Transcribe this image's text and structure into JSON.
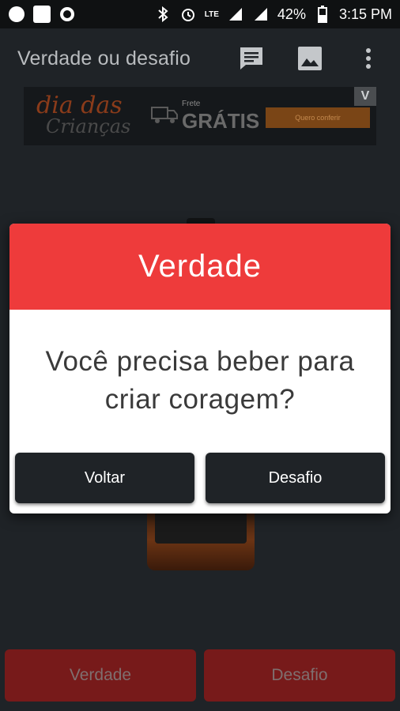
{
  "status_bar": {
    "network": "LTE",
    "battery": "42%",
    "time": "3:15 PM"
  },
  "app_bar": {
    "title": "Verdade ou desafio",
    "icons": [
      "message-icon",
      "image-icon",
      "more-vert-icon"
    ]
  },
  "ad": {
    "title": "dia das",
    "subtitle": "Crianças",
    "frete": "Frete",
    "gratis": "GRÁTIS",
    "cta": "Quero conferir",
    "badge": "V"
  },
  "dialog": {
    "title": "Verdade",
    "message": "Você precisa beber para criar coragem?",
    "back_label": "Voltar",
    "dare_label": "Desafio",
    "accent": "#ee3b3b"
  },
  "bottom": {
    "truth_label": "Verdade",
    "dare_label": "Desafio"
  },
  "colors": {
    "background": "#1f2327",
    "dialog_header": "#ee3b3b",
    "bottom_button": "#771a1a"
  }
}
